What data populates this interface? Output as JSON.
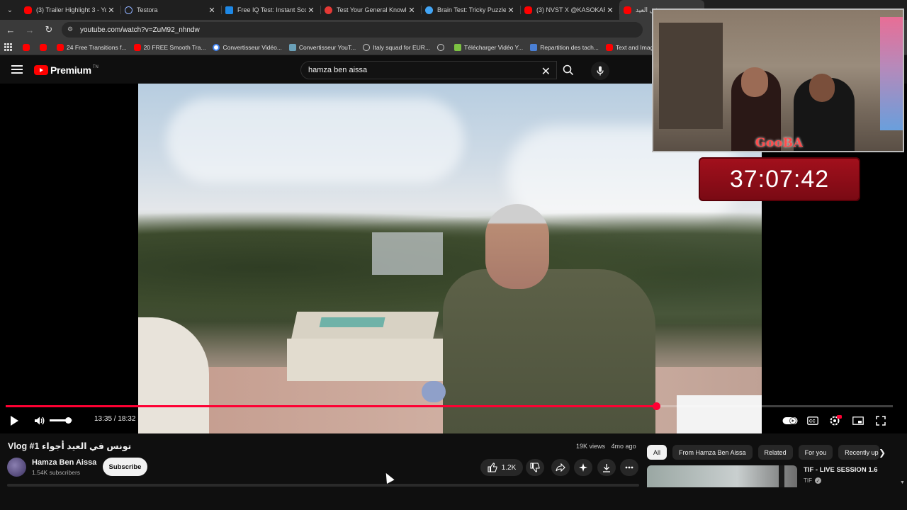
{
  "tabs": [
    {
      "title": "(3) Trailer Highlight 3 - You",
      "color": "#ff0000",
      "icon": "youtube-icon"
    },
    {
      "title": "Testora",
      "color": "#8fb0ff",
      "icon": "testora-icon"
    },
    {
      "title": "Free IQ Test: Instant Score",
      "color": "#1e88e5",
      "icon": "iq-icon"
    },
    {
      "title": "Test Your General Knowled",
      "color": "#e53935",
      "icon": "quiz-icon"
    },
    {
      "title": "Brain Test: Tricky Puzzles -",
      "color": "#42a5f5",
      "icon": "brain-icon"
    },
    {
      "title": "(3) NVST X @KASOKARIM",
      "color": "#ff0000",
      "icon": "youtube-icon"
    },
    {
      "title": "تونس في العيد",
      "color": "#ff0000",
      "icon": "youtube-icon"
    }
  ],
  "address": {
    "url": "youtube.com/watch?v=ZuM92_nhndw"
  },
  "bookmarks": [
    {
      "label": "",
      "icon": "youtube-icon"
    },
    {
      "label": "",
      "icon": "youtube-icon"
    },
    {
      "label": "24 Free Transitions f...",
      "icon": "youtube-icon"
    },
    {
      "label": "20 FREE Smooth Tra...",
      "icon": "youtube-icon"
    },
    {
      "label": "Convertisseur Vidéo...",
      "icon": "google-icon"
    },
    {
      "label": "Convertisseur YouT...",
      "icon": "converter-icon"
    },
    {
      "label": "Italy squad for EUR...",
      "icon": "globe-icon"
    },
    {
      "label": "",
      "icon": "globe-icon"
    },
    {
      "label": "Télécharger Vidéo Y...",
      "icon": "download-icon"
    },
    {
      "label": "Repartition des tach...",
      "icon": "doc-icon"
    },
    {
      "label": "Text and Image ani...",
      "icon": "youtube-icon"
    }
  ],
  "header": {
    "logo_word": "Premium",
    "logo_tm": "TN",
    "search_value": "hamza ben aissa"
  },
  "player": {
    "current_time": "13:35",
    "duration": "18:32",
    "time_display": "13:35 / 18:32",
    "progress_fraction": 0.733,
    "volume_fraction": 0.8,
    "accent_color": "#ff0033"
  },
  "overlay": {
    "webcam_tag": "GooBA",
    "timer": "37:07:42"
  },
  "video": {
    "title": "تونس في العيد أجواء Vlog #1",
    "channel": "Hamza Ben Aissa",
    "subscribers": "1.54K subscribers",
    "subscribe_label": "Subscribe",
    "views": "19K views",
    "age": "4mo ago",
    "likes": "1.2K"
  },
  "chips": [
    "All",
    "From Hamza Ben Aissa",
    "Related",
    "For you",
    "Recently up"
  ],
  "related": {
    "title": "TIF - LIVE SESSION 1.6",
    "channel": "TIF"
  }
}
